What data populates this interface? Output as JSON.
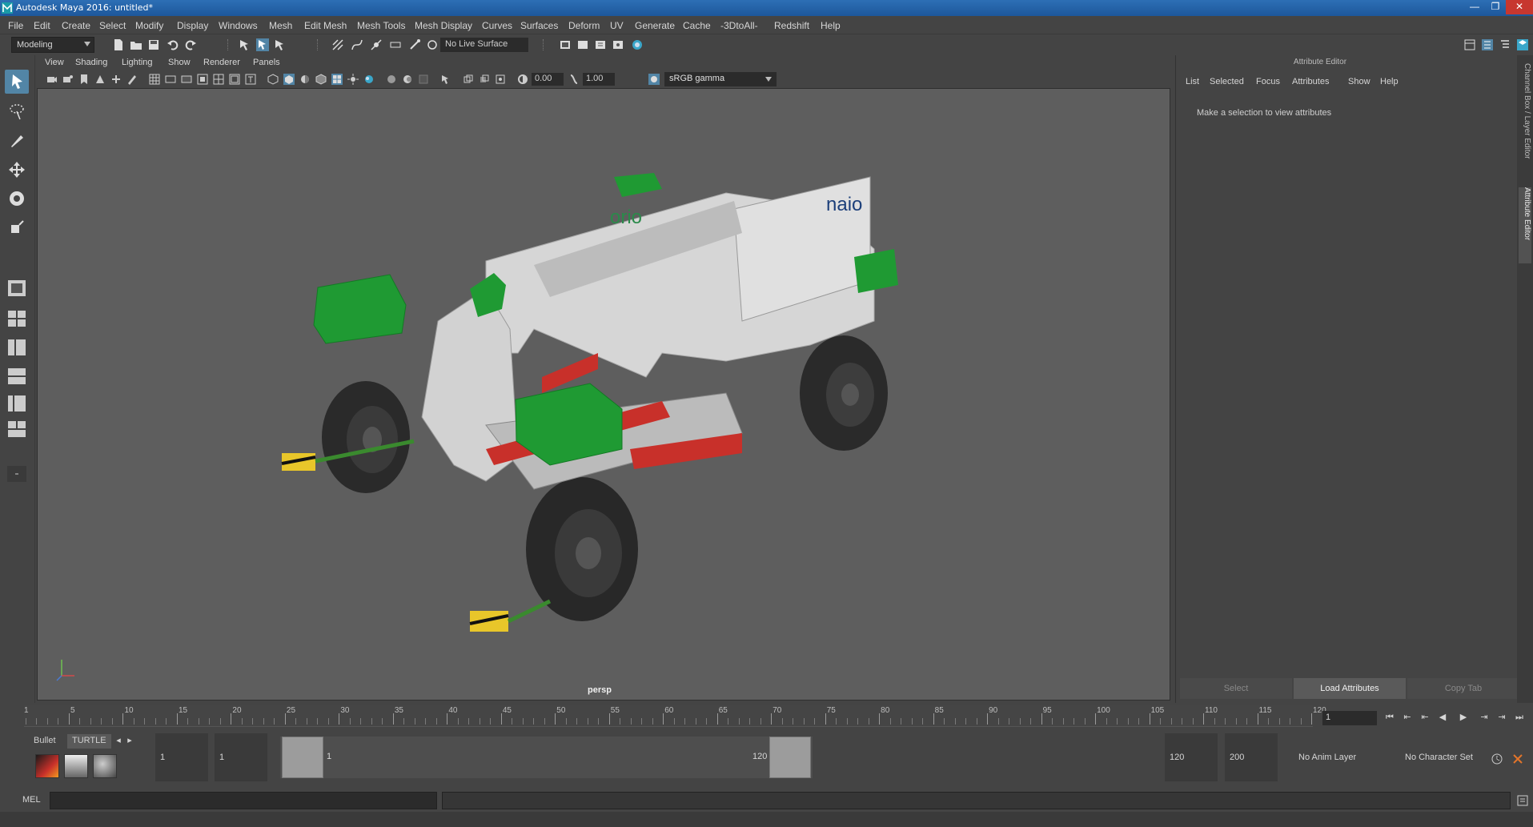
{
  "window": {
    "title": "Autodesk Maya 2016: untitled*"
  },
  "menubar": [
    "File",
    "Edit",
    "Create",
    "Select",
    "Modify",
    "Display",
    "Windows",
    "Mesh",
    "Edit Mesh",
    "Mesh Tools",
    "Mesh Display",
    "Curves",
    "Surfaces",
    "Deform",
    "UV",
    "Generate",
    "Cache",
    "-3DtoAll-",
    "Redshift",
    "Help"
  ],
  "toolbar": {
    "mode": "Modeling",
    "live_surface": "No Live Surface"
  },
  "viewport": {
    "menus": [
      "View",
      "Shading",
      "Lighting",
      "Show",
      "Renderer",
      "Panels"
    ],
    "exposure": "0.00",
    "gamma": "1.00",
    "colorspace": "sRGB gamma",
    "camera": "persp",
    "model_label_left": "orio",
    "model_label_right": "naio"
  },
  "attribute_editor": {
    "title": "Attribute Editor",
    "menus": [
      "List",
      "Selected",
      "Focus",
      "Attributes",
      "Show",
      "Help"
    ],
    "message": "Make a selection to view attributes",
    "buttons": {
      "select": "Select",
      "load": "Load Attributes",
      "copy": "Copy Tab"
    },
    "side_tabs": [
      "Channel Box / Layer Editor",
      "Attribute Editor"
    ]
  },
  "timeslider": {
    "ticks": [
      "5",
      "10",
      "15",
      "20",
      "25",
      "30",
      "35",
      "40",
      "45",
      "50",
      "55",
      "60",
      "65",
      "70",
      "75",
      "80",
      "85",
      "90",
      "95",
      "100",
      "105",
      "110",
      "115",
      "120"
    ],
    "current_marker": "1",
    "current_frame": "1"
  },
  "range": {
    "shelf_tabs": [
      "Bullet",
      "TURTLE"
    ],
    "start_anim": "1",
    "start_play": "1",
    "slider_start": "1",
    "slider_end": "120",
    "end_play": "120",
    "end_anim": "200",
    "anim_layer": "No Anim Layer",
    "char_set": "No Character Set"
  },
  "cmdline": {
    "label": "MEL"
  }
}
